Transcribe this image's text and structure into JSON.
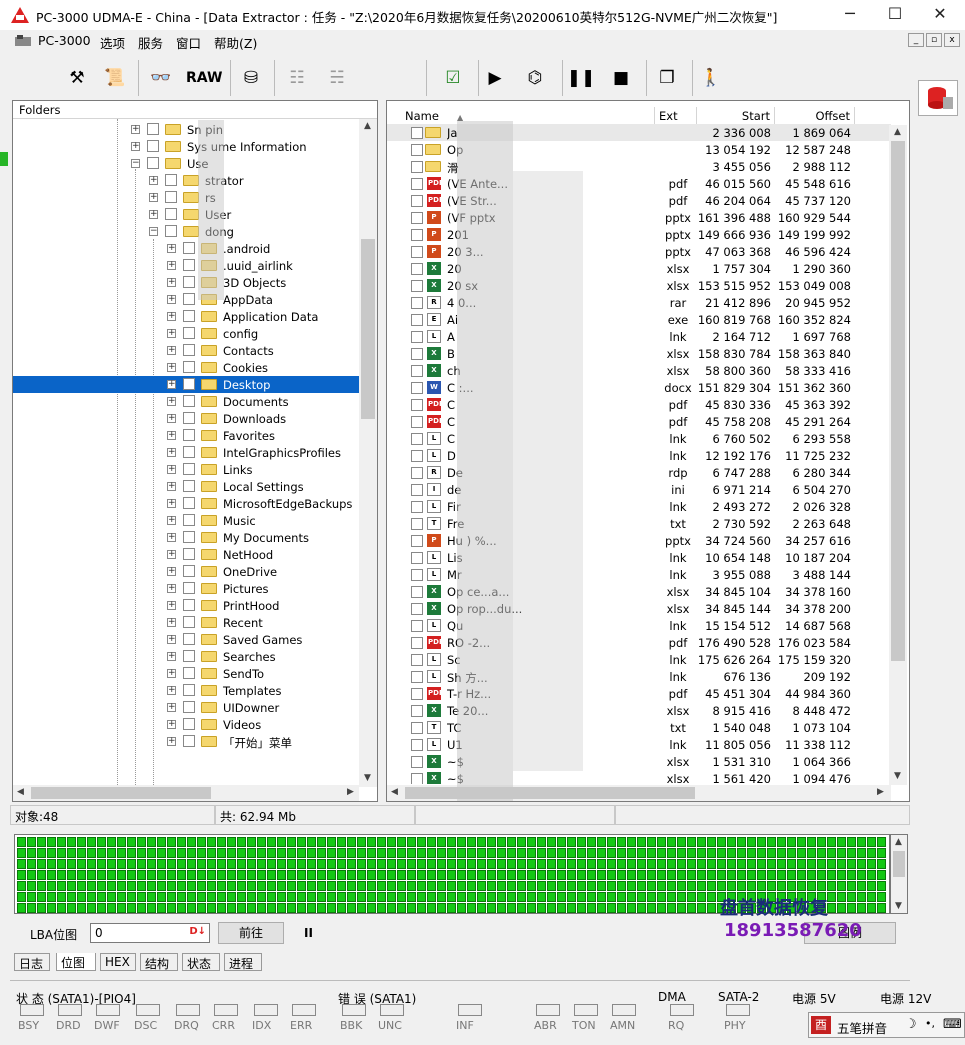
{
  "window": {
    "title": "PC-3000 UDMA-E - China - [Data Extractor : 任务 - \"Z:\\2020年6月数据恢复任务\\20200610英特尔512G-NVME广州二次恢复\"]",
    "minimize": "─",
    "maximize": "☐",
    "close": "✕"
  },
  "menu": [
    "PC-3000",
    "选项",
    "服务",
    "窗口",
    "帮助(Z)"
  ],
  "mdi": {
    "min": "_",
    "restore": "▫",
    "close": "x"
  },
  "toolbar": {
    "raw": "RAW"
  },
  "folders": {
    "header": "Folders",
    "items": [
      {
        "label": "Sn      pin",
        "level": 0
      },
      {
        "label": "Sys      ume Information",
        "level": 0
      },
      {
        "label": "Use",
        "level": 0,
        "open": true
      },
      {
        "label": "      strator",
        "level": 1
      },
      {
        "label": "      rs",
        "level": 1
      },
      {
        "label": "      User",
        "level": 1
      },
      {
        "label": "      dong",
        "level": 1,
        "open": true
      },
      {
        "label": ".android",
        "level": 2
      },
      {
        "label": ".uuid_airlink",
        "level": 2
      },
      {
        "label": "3D Objects",
        "level": 2
      },
      {
        "label": "AppData",
        "level": 2
      },
      {
        "label": "Application Data",
        "level": 2
      },
      {
        "label": "config",
        "level": 2
      },
      {
        "label": "Contacts",
        "level": 2
      },
      {
        "label": "Cookies",
        "level": 2
      },
      {
        "label": "Desktop",
        "level": 2,
        "selected": true
      },
      {
        "label": "Documents",
        "level": 2
      },
      {
        "label": "Downloads",
        "level": 2
      },
      {
        "label": "Favorites",
        "level": 2
      },
      {
        "label": "IntelGraphicsProfiles",
        "level": 2
      },
      {
        "label": "Links",
        "level": 2
      },
      {
        "label": "Local Settings",
        "level": 2
      },
      {
        "label": "MicrosoftEdgeBackups",
        "level": 2
      },
      {
        "label": "Music",
        "level": 2
      },
      {
        "label": "My Documents",
        "level": 2
      },
      {
        "label": "NetHood",
        "level": 2
      },
      {
        "label": "OneDrive",
        "level": 2
      },
      {
        "label": "Pictures",
        "level": 2
      },
      {
        "label": "PrintHood",
        "level": 2
      },
      {
        "label": "Recent",
        "level": 2
      },
      {
        "label": "Saved Games",
        "level": 2
      },
      {
        "label": "Searches",
        "level": 2
      },
      {
        "label": "SendTo",
        "level": 2
      },
      {
        "label": "Templates",
        "level": 2
      },
      {
        "label": "UIDowner",
        "level": 2
      },
      {
        "label": "Videos",
        "level": 2
      },
      {
        "label": "「开始」菜单",
        "level": 2
      }
    ]
  },
  "files": {
    "columns": {
      "name": "Name",
      "ext": "Ext",
      "start": "Start",
      "offset": "Offset"
    },
    "rows": [
      {
        "name": "Ja",
        "ext": "",
        "start": "2 336 008",
        "offset": "1 869 064",
        "icon": "folder"
      },
      {
        "name": "Op",
        "ext": "",
        "start": "13 054 192",
        "offset": "12 587 248",
        "icon": "folder"
      },
      {
        "name": "滑",
        "ext": "",
        "start": "3 455 056",
        "offset": "2 988 112",
        "icon": "folder"
      },
      {
        "name": "(VE                                    Ante...",
        "ext": "pdf",
        "start": "46 015 560",
        "offset": "45 548 616",
        "icon": "PDF"
      },
      {
        "name": "(VE                                    Str...",
        "ext": "pdf",
        "start": "46 204 064",
        "offset": "45 737 120",
        "icon": "PDF"
      },
      {
        "name": "(VF                                    pptx",
        "ext": "pptx",
        "start": "161 396 488",
        "offset": "160 929 544",
        "icon": "P"
      },
      {
        "name": "201",
        "ext": "pptx",
        "start": "149 666 936",
        "offset": "149 199 992",
        "icon": "P"
      },
      {
        "name": "20                                     3...",
        "ext": "pptx",
        "start": "47 063 368",
        "offset": "46 596 424",
        "icon": "P"
      },
      {
        "name": "20",
        "ext": "xlsx",
        "start": "1 757 304",
        "offset": "1 290 360",
        "icon": "X"
      },
      {
        "name": "20                                     sx",
        "ext": "xlsx",
        "start": "153 515 952",
        "offset": "153 049 008",
        "icon": "X"
      },
      {
        "name": "4                                      0...",
        "ext": "rar",
        "start": "21 412 896",
        "offset": "20 945 952",
        "icon": "R"
      },
      {
        "name": "Ai",
        "ext": "exe",
        "start": "160 819 768",
        "offset": "160 352 824",
        "icon": "E"
      },
      {
        "name": "A",
        "ext": "lnk",
        "start": "2 164 712",
        "offset": "1 697 768",
        "icon": "L"
      },
      {
        "name": "B",
        "ext": "xlsx",
        "start": "158 830 784",
        "offset": "158 363 840",
        "icon": "X"
      },
      {
        "name": "ch",
        "ext": "xlsx",
        "start": "58 800 360",
        "offset": "58 333 416",
        "icon": "X"
      },
      {
        "name": "C                                      :...",
        "ext": "docx",
        "start": "151 829 304",
        "offset": "151 362 360",
        "icon": "W"
      },
      {
        "name": "C",
        "ext": "pdf",
        "start": "45 830 336",
        "offset": "45 363 392",
        "icon": "PDF"
      },
      {
        "name": "C",
        "ext": "pdf",
        "start": "45 758 208",
        "offset": "45 291 264",
        "icon": "PDF"
      },
      {
        "name": "C",
        "ext": "lnk",
        "start": "6 760 502",
        "offset": "6 293 558",
        "icon": "L"
      },
      {
        "name": "D",
        "ext": "lnk",
        "start": "12 192 176",
        "offset": "11 725 232",
        "icon": "L"
      },
      {
        "name": "De",
        "ext": "rdp",
        "start": "6 747 288",
        "offset": "6 280 344",
        "icon": "R"
      },
      {
        "name": "de",
        "ext": "ini",
        "start": "6 971 214",
        "offset": "6 504 270",
        "icon": "I"
      },
      {
        "name": "Fir",
        "ext": "lnk",
        "start": "2 493 272",
        "offset": "2 026 328",
        "icon": "L"
      },
      {
        "name": "Fre",
        "ext": "txt",
        "start": "2 730 592",
        "offset": "2 263 648",
        "icon": "T"
      },
      {
        "name": "Hu                                     ) %...",
        "ext": "pptx",
        "start": "34 724 560",
        "offset": "34 257 616",
        "icon": "P"
      },
      {
        "name": "Lis",
        "ext": "lnk",
        "start": "10 654 148",
        "offset": "10 187 204",
        "icon": "L"
      },
      {
        "name": "Mr",
        "ext": "lnk",
        "start": "3 955 088",
        "offset": "3 488 144",
        "icon": "L"
      },
      {
        "name": "Op                                     ce...a...",
        "ext": "xlsx",
        "start": "34 845 104",
        "offset": "34 378 160",
        "icon": "X"
      },
      {
        "name": "Op                                     rop...du...",
        "ext": "xlsx",
        "start": "34 845 144",
        "offset": "34 378 200",
        "icon": "X"
      },
      {
        "name": "Qu",
        "ext": "lnk",
        "start": "15 154 512",
        "offset": "14 687 568",
        "icon": "L"
      },
      {
        "name": "RO                                     -2...",
        "ext": "pdf",
        "start": "176 490 528",
        "offset": "176 023 584",
        "icon": "PDF"
      },
      {
        "name": "Sc",
        "ext": "lnk",
        "start": "175 626 264",
        "offset": "175 159 320",
        "icon": "L"
      },
      {
        "name": "Sh                                     方...",
        "ext": "lnk",
        "start": "676 136",
        "offset": "209 192",
        "icon": "L"
      },
      {
        "name": "T-r                                    Hz...",
        "ext": "pdf",
        "start": "45 451 304",
        "offset": "44 984 360",
        "icon": "PDF"
      },
      {
        "name": "Te                                     20...",
        "ext": "xlsx",
        "start": "8 915 416",
        "offset": "8 448 472",
        "icon": "X"
      },
      {
        "name": "TC",
        "ext": "txt",
        "start": "1 540 048",
        "offset": "1 073 104",
        "icon": "T"
      },
      {
        "name": "U1",
        "ext": "lnk",
        "start": "11 805 056",
        "offset": "11 338 112",
        "icon": "L"
      },
      {
        "name": "~$",
        "ext": "xlsx",
        "start": "1 531 310",
        "offset": "1 064 366",
        "icon": "X"
      },
      {
        "name": "~$",
        "ext": "xlsx",
        "start": "1 561 420",
        "offset": "1 094 476",
        "icon": "X"
      }
    ]
  },
  "status": {
    "objects": "对象:48",
    "total": "共:  62.94 Mb"
  },
  "lba": {
    "label": "LBA位图",
    "value": "0",
    "go": "前往",
    "pause": "II",
    "legend": "图例"
  },
  "watermark": {
    "name": "盘首数据恢复",
    "phone": "18913587620"
  },
  "tabs": [
    "日志",
    "位图",
    "HEX",
    "结构",
    "状态",
    "进程"
  ],
  "groups": {
    "state": "状 态 (SATA1)-[PIO4]",
    "error": "错 误 (SATA1)",
    "dma": "DMA",
    "sata2": "SATA-2",
    "p5": "电源 5V",
    "p12": "电源 12V"
  },
  "leds": [
    "BSY",
    "DRD",
    "DWF",
    "DSC",
    "DRQ",
    "CRR",
    "IDX",
    "ERR",
    "BBK",
    "UNC",
    "INF",
    "ABR",
    "TON",
    "AMN",
    "RQ",
    "PHY"
  ],
  "ime": {
    "label": "五笔拼音"
  },
  "colors": {
    "selection": "#0a64c8",
    "bitmap": "#14c814",
    "pdf": "#d42020",
    "excel": "#1d7a3a",
    "ppt": "#d04a1a",
    "word": "#2a56b0"
  }
}
